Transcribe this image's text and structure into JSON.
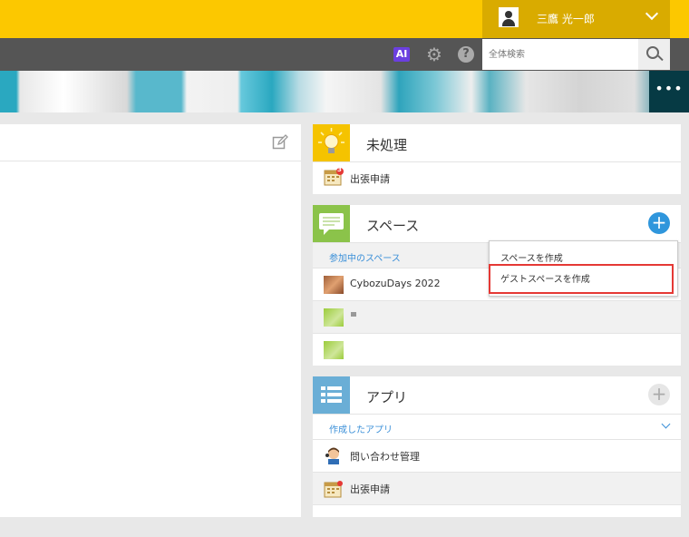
{
  "header": {
    "user_name": "三鷹 光一郎",
    "search_placeholder": "全体検索",
    "ai_label": "AI"
  },
  "unprocessed": {
    "title": "未処理",
    "badge": "3",
    "items": [
      {
        "label": "出張申請"
      }
    ]
  },
  "space": {
    "title": "スペース",
    "section_label": "参加中のスペース",
    "items": [
      {
        "label": "CybozuDays 2022"
      },
      {
        "label": ""
      },
      {
        "label": ""
      }
    ],
    "menu": [
      {
        "label": "スペースを作成"
      },
      {
        "label": "ゲストスペースを作成"
      }
    ]
  },
  "app": {
    "title": "アプリ",
    "section_label": "作成したアプリ",
    "items": [
      {
        "label": "問い合わせ管理"
      },
      {
        "label": "出張申請"
      }
    ]
  },
  "colors": {
    "topbar": "#fcc800",
    "accent_blue": "#3a8fd8",
    "highlight": "#e53935"
  }
}
